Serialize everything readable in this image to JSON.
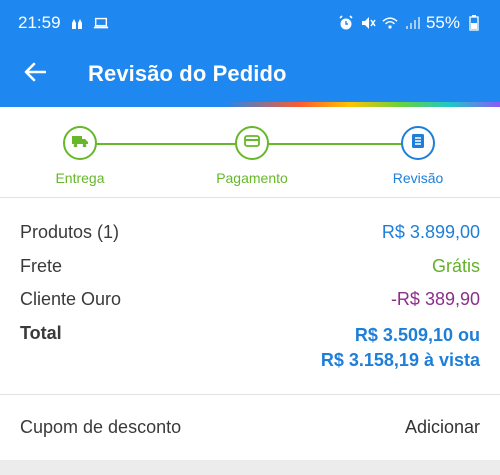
{
  "status_bar": {
    "time": "21:59",
    "battery": "55%",
    "icons": [
      "hands-icon",
      "laptop-icon",
      "alarm-icon",
      "mute-icon",
      "wifi-icon",
      "signal-icon",
      "battery-icon"
    ]
  },
  "header": {
    "title": "Revisão do Pedido",
    "back_icon": "arrow-left-icon"
  },
  "stepper": {
    "steps": [
      {
        "label": "Entrega",
        "icon": "truck-icon",
        "state": "done"
      },
      {
        "label": "Pagamento",
        "icon": "card-icon",
        "state": "done"
      },
      {
        "label": "Revisão",
        "icon": "list-icon",
        "state": "active"
      }
    ]
  },
  "summary": {
    "produtos_label": "Produtos (1)",
    "produtos_value": "R$ 3.899,00",
    "frete_label": "Frete",
    "frete_value": "Grátis",
    "cliente_label": "Cliente Ouro",
    "cliente_value": "-R$ 389,90",
    "total_label": "Total",
    "total_line1": "R$ 3.509,10 ou",
    "total_line2": "R$ 3.158,19 à vista"
  },
  "coupon": {
    "label": "Cupom de desconto",
    "action": "Adicionar"
  },
  "colors": {
    "primary": "#1e88f0",
    "success": "#66b82a",
    "discount": "#8b2f8b"
  }
}
